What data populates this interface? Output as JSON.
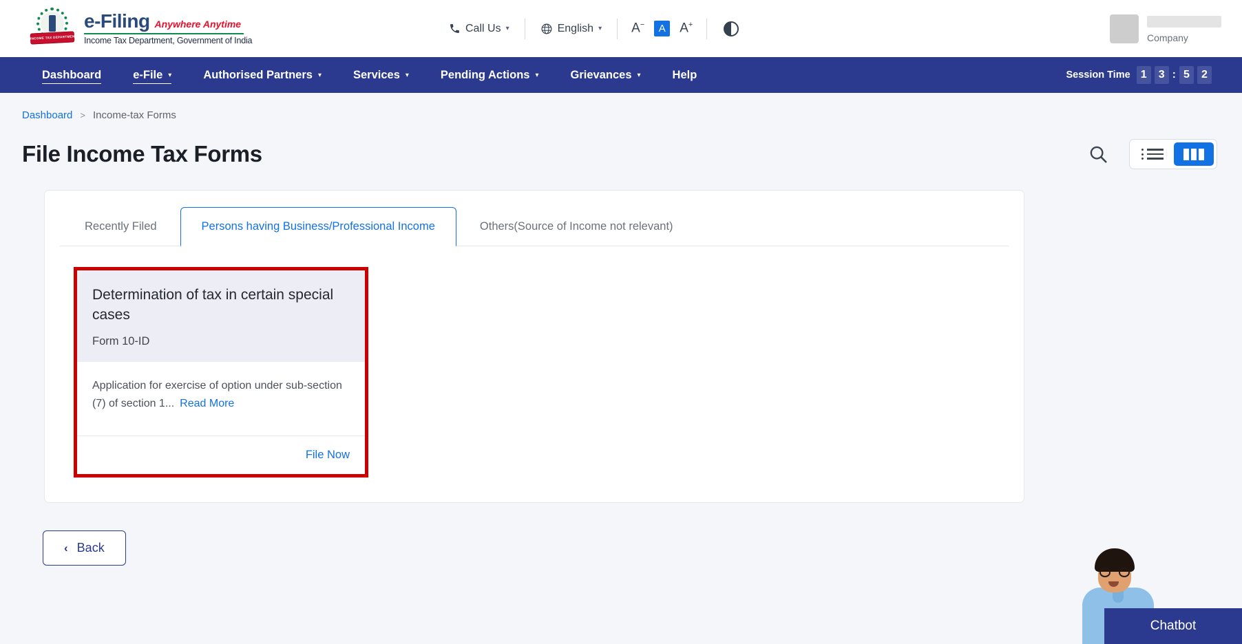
{
  "header": {
    "brand": {
      "title": "e-Filing",
      "tagline": "Anywhere Anytime",
      "department": "Income Tax Department, Government of India",
      "emblem_ribbon": "INCOME TAX DEPARTMENT"
    },
    "utilities": {
      "call_us": "Call Us",
      "language": "English",
      "font_decrease": "A",
      "font_normal": "A",
      "font_increase": "A",
      "contrast_icon": "contrast-icon"
    },
    "user": {
      "company_label": "Company"
    }
  },
  "nav": {
    "items": [
      {
        "label": "Dashboard",
        "has_caret": false,
        "active": false
      },
      {
        "label": "e-File",
        "has_caret": true,
        "active": true
      },
      {
        "label": "Authorised Partners",
        "has_caret": true,
        "active": false
      },
      {
        "label": "Services",
        "has_caret": true,
        "active": false
      },
      {
        "label": "Pending Actions",
        "has_caret": true,
        "active": false
      },
      {
        "label": "Grievances",
        "has_caret": true,
        "active": false
      },
      {
        "label": "Help",
        "has_caret": false,
        "active": false
      }
    ],
    "session": {
      "label": "Session Time",
      "d1": "1",
      "d2": "3",
      "separator": ":",
      "d3": "5",
      "d4": "2"
    }
  },
  "breadcrumb": {
    "home": "Dashboard",
    "separator": ">",
    "current": "Income-tax Forms"
  },
  "page": {
    "title": "File Income Tax Forms",
    "search_icon": "search-icon",
    "view_list": "list-view-icon",
    "view_grid": "grid-view-icon",
    "active_view": "grid"
  },
  "tabs": [
    {
      "label": "Recently Filed",
      "selected": false
    },
    {
      "label": "Persons having Business/Professional Income",
      "selected": true
    },
    {
      "label": "Others(Source of Income not relevant)",
      "selected": false
    }
  ],
  "form_card": {
    "title": "Determination of tax in certain special cases",
    "form_number": "Form 10-ID",
    "description": "Application for exercise of option under sub-section (7) of section 1...",
    "read_more": "Read More",
    "file_now": "File Now",
    "highlight_color": "#cc0000"
  },
  "footer": {
    "back_label": "Back",
    "back_icon": "chevron-left-icon"
  },
  "chatbot": {
    "label": "Chatbot"
  },
  "colors": {
    "nav_blue": "#2b3a8f",
    "accent_blue": "#1271e3",
    "page_bg": "#f4f6fa",
    "card_head_bg": "#ecedf5",
    "highlight_red": "#cc0000"
  }
}
